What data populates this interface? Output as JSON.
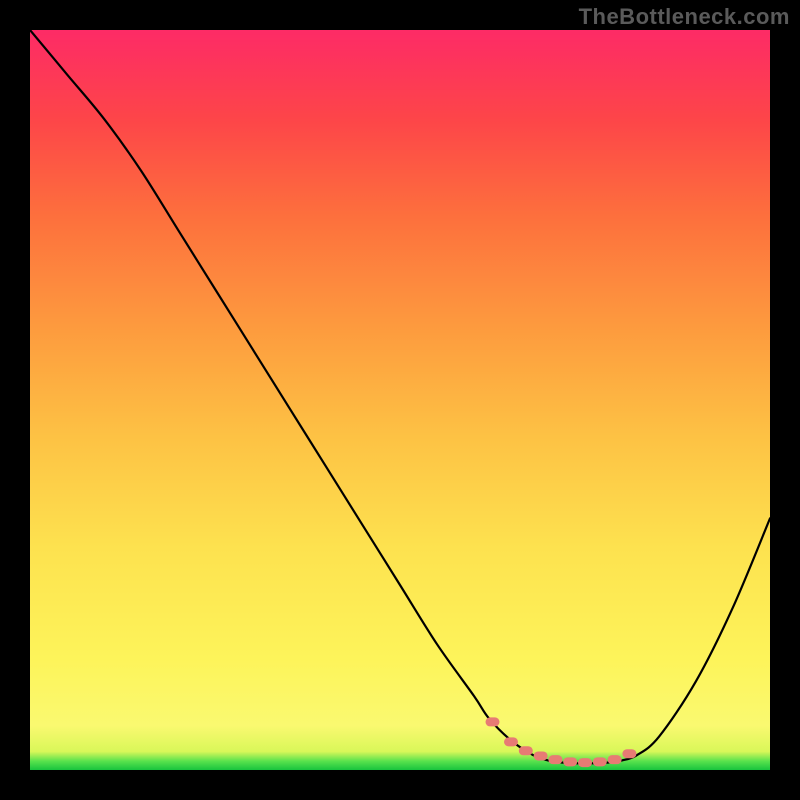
{
  "watermark": "TheBottleneck.com",
  "chart_data": {
    "type": "line",
    "title": "",
    "xlabel": "",
    "ylabel": "",
    "xlim": [
      0,
      100
    ],
    "ylim": [
      0,
      100
    ],
    "series": [
      {
        "name": "bottleneck-curve",
        "x": [
          0,
          5,
          10,
          15,
          20,
          25,
          30,
          35,
          40,
          45,
          50,
          55,
          60,
          62,
          65,
          68,
          70,
          72,
          75,
          78,
          80,
          82,
          85,
          90,
          95,
          100
        ],
        "y": [
          100,
          94,
          88,
          81,
          73,
          65,
          57,
          49,
          41,
          33,
          25,
          17,
          10,
          7,
          4,
          2,
          1.3,
          1.0,
          0.9,
          1.0,
          1.3,
          2.0,
          4.5,
          12,
          22,
          34
        ]
      }
    ],
    "markers": {
      "name": "highlight-dots",
      "color": "#e77b74",
      "x": [
        62.5,
        65,
        67,
        69,
        71,
        73,
        75,
        77,
        79,
        81
      ],
      "y": [
        6.5,
        3.8,
        2.6,
        1.9,
        1.4,
        1.1,
        1.0,
        1.1,
        1.4,
        2.2
      ]
    },
    "gradient_stops": [
      {
        "pos": 0.0,
        "color": "#18c43e"
      },
      {
        "pos": 0.012,
        "color": "#59e24d"
      },
      {
        "pos": 0.025,
        "color": "#d9f759"
      },
      {
        "pos": 0.06,
        "color": "#faf970"
      },
      {
        "pos": 0.15,
        "color": "#fdf45a"
      },
      {
        "pos": 0.3,
        "color": "#fde24f"
      },
      {
        "pos": 0.45,
        "color": "#fdc244"
      },
      {
        "pos": 0.6,
        "color": "#fd9a3e"
      },
      {
        "pos": 0.75,
        "color": "#fd6f3d"
      },
      {
        "pos": 0.88,
        "color": "#fd4549"
      },
      {
        "pos": 1.0,
        "color": "#fd2b66"
      }
    ]
  }
}
